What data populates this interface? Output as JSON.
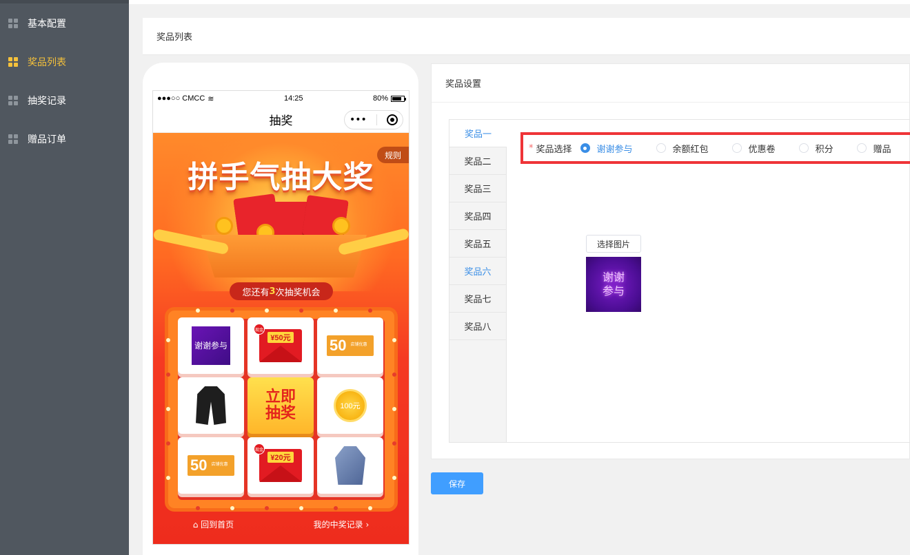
{
  "sidebar": {
    "items": [
      {
        "label": "基本配置",
        "active": false
      },
      {
        "label": "奖品列表",
        "active": true
      },
      {
        "label": "抽奖记录",
        "active": false
      },
      {
        "label": "赠品订单",
        "active": false
      }
    ]
  },
  "header": {
    "title": "奖品列表"
  },
  "phone": {
    "status": {
      "carrier": "●●●○○ CMCC",
      "time": "14:25",
      "battery": "80%"
    },
    "nav_title": "抽奖",
    "capsule_more": "•••",
    "rules": "规则",
    "banner_title": "拼手气抽大奖",
    "chance_prefix": "您还有",
    "chance_count": "3",
    "chance_suffix": "次抽奖机会",
    "grid": {
      "thanks": "谢谢参与",
      "redpack_50": "¥50元",
      "coupon_num": "50",
      "coupon_sub": "店铺优惠",
      "center_line1": "立即",
      "center_line2": "抽奖",
      "coin_100": "100元",
      "redpack_20": "¥20元",
      "redpack_tag": "现金"
    },
    "footer": {
      "home": "回到首页",
      "records": "我的中奖记录"
    }
  },
  "panel": {
    "title": "奖品设置",
    "tabs": [
      "奖品一",
      "奖品二",
      "奖品三",
      "奖品四",
      "奖品五",
      "奖品六",
      "奖品七",
      "奖品八"
    ],
    "selector_label": "奖品选择",
    "options": [
      {
        "label": "谢谢参与",
        "checked": true
      },
      {
        "label": "余额红包",
        "checked": false
      },
      {
        "label": "优惠卷",
        "checked": false
      },
      {
        "label": "积分",
        "checked": false
      },
      {
        "label": "赠品",
        "checked": false
      }
    ],
    "pick_image": "选择图片",
    "prize_image_text": "谢谢参与"
  },
  "save_label": "保存",
  "colors": {
    "sidebar": "#50575f",
    "active": "#f5c13b",
    "primary": "#409eff",
    "highlight": "#ef3438"
  }
}
